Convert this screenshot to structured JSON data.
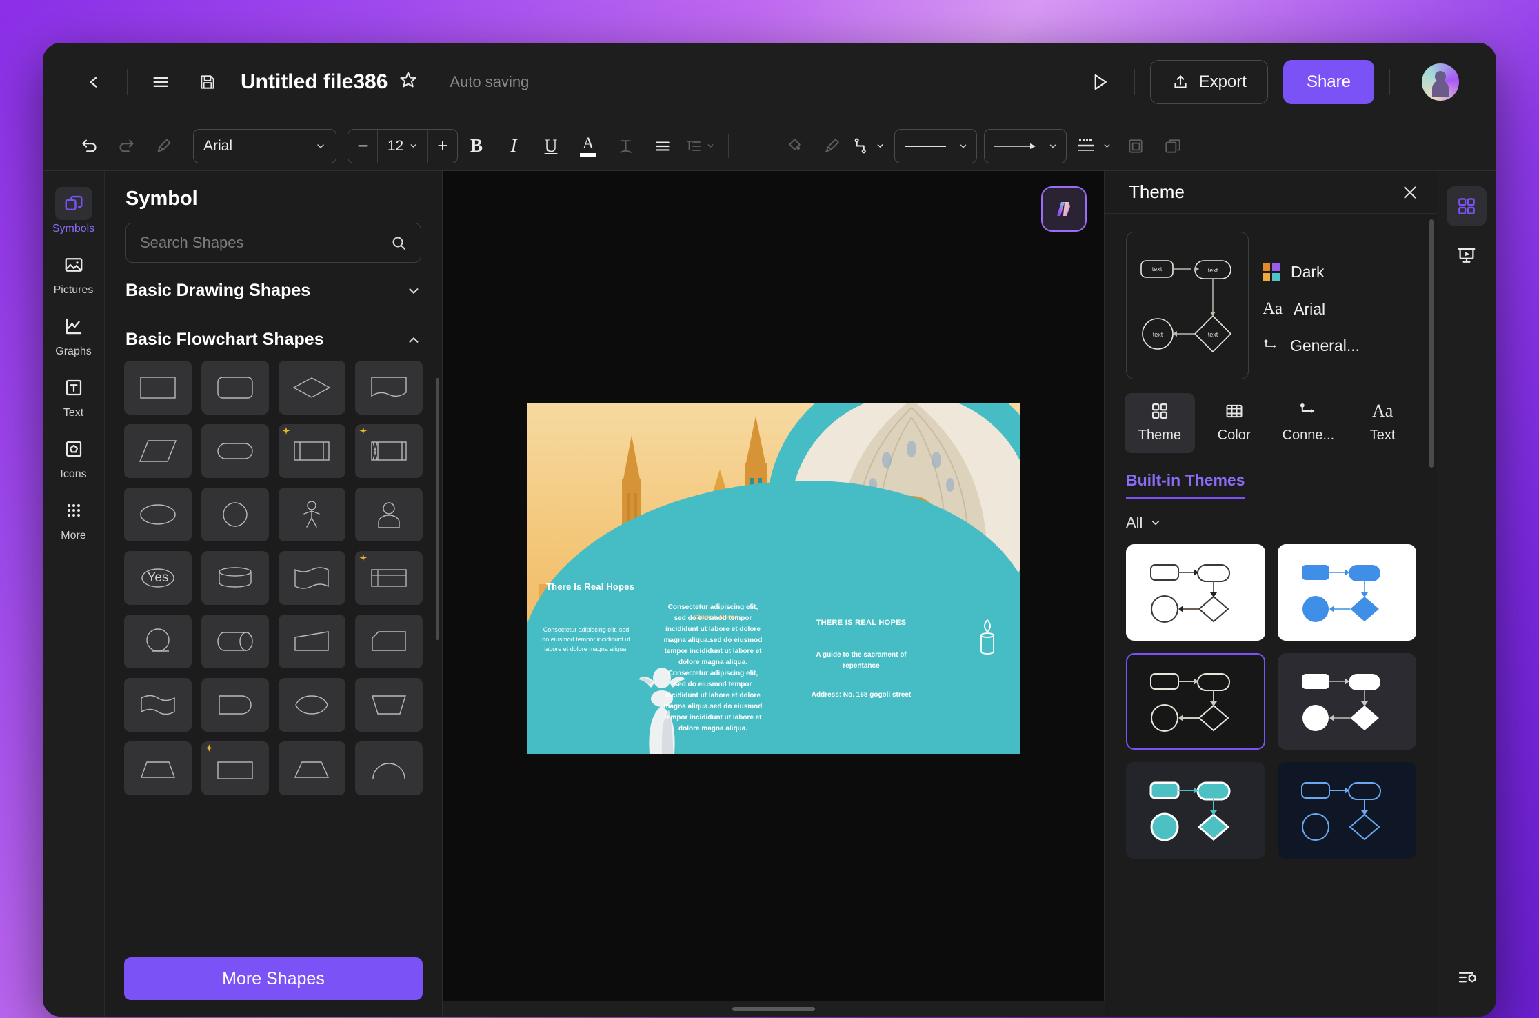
{
  "titlebar": {
    "back_icon": "chevron-left-icon",
    "menu_icon": "hamburger-menu-icon",
    "save_icon": "floppy-save-icon",
    "doc_title": "Untitled file386",
    "star_icon": "star-icon",
    "autosave_status": "Auto saving",
    "present_icon": "play-present-icon",
    "export_label": "Export",
    "share_label": "Share",
    "avatar": "user-avatar"
  },
  "toolbar": {
    "undo_icon": "undo-icon",
    "redo_icon": "redo-icon",
    "painter_icon": "format-painter-icon",
    "font_family": "Arial",
    "font_size": "12",
    "decrease": "−",
    "increase": "+",
    "bold": "B",
    "italic": "I",
    "underline": "U",
    "font_color": "A",
    "text_effect_icon": "text-effect-icon",
    "align_icon": "align-icon",
    "line_spacing_icon": "line-spacing-icon",
    "text_box_icon": "text-box-icon",
    "fill_icon": "fill-bucket-icon",
    "brush_icon": "brush-icon",
    "connector_icon": "connector-icon",
    "line_style_icon": "line-style-icon",
    "arrow_style_icon": "arrow-style-icon",
    "line_weight_icon": "line-weight-icon",
    "frame_icon": "frame-icon",
    "layer_icon": "layers-icon"
  },
  "left_rail": {
    "items": [
      {
        "label": "Symbols",
        "icon": "symbols-icon",
        "active": true
      },
      {
        "label": "Pictures",
        "icon": "picture-icon",
        "active": false
      },
      {
        "label": "Graphs",
        "icon": "graph-icon",
        "active": false
      },
      {
        "label": "Text",
        "icon": "text-icon",
        "active": false
      },
      {
        "label": "Icons",
        "icon": "icons-icon",
        "active": false
      },
      {
        "label": "More",
        "icon": "more-dots-icon",
        "active": false
      }
    ]
  },
  "symbol_panel": {
    "title": "Symbol",
    "search_placeholder": "Search Shapes",
    "search_value": "",
    "search_icon": "search-icon",
    "sections": [
      {
        "label": "Basic Drawing Shapes",
        "expanded": false,
        "chevron": "chevron-down-icon"
      },
      {
        "label": "Basic Flowchart Shapes",
        "expanded": true,
        "chevron": "chevron-up-icon"
      }
    ],
    "shapes": [
      {
        "name": "process-rectangle",
        "starred": false
      },
      {
        "name": "rounded-rectangle",
        "starred": false
      },
      {
        "name": "decision-diamond",
        "starred": false
      },
      {
        "name": "document-shape",
        "starred": false
      },
      {
        "name": "parallelogram-data",
        "starred": false
      },
      {
        "name": "stadium-terminator",
        "starred": false
      },
      {
        "name": "predefined-process",
        "starred": true
      },
      {
        "name": "internal-storage",
        "starred": true
      },
      {
        "name": "ellipse-shape",
        "starred": false
      },
      {
        "name": "circle-shape",
        "starred": false
      },
      {
        "name": "actor-person",
        "starred": false
      },
      {
        "name": "user-avatar-shape",
        "starred": false
      },
      {
        "name": "yes-ellipse",
        "starred": false,
        "text": "Yes"
      },
      {
        "name": "database-cylinder",
        "starred": false
      },
      {
        "name": "tape-shape",
        "starred": false
      },
      {
        "name": "table-shape",
        "starred": true
      },
      {
        "name": "circle-outline-shape",
        "starred": false
      },
      {
        "name": "direct-access-storage",
        "starred": false
      },
      {
        "name": "trapezoid-slant",
        "starred": false
      },
      {
        "name": "card-shape",
        "starred": false
      },
      {
        "name": "wave-document",
        "starred": false
      },
      {
        "name": "delay-shape",
        "starred": false
      },
      {
        "name": "loop-limit-shape",
        "starred": false
      },
      {
        "name": "manual-operation",
        "starred": false
      },
      {
        "name": "trapezoid-shape",
        "starred": false
      },
      {
        "name": "rect-partial",
        "starred": true
      },
      {
        "name": "hexagon-partial",
        "starred": false
      },
      {
        "name": "arc-partial",
        "starred": false
      }
    ],
    "more_shapes_label": "More Shapes"
  },
  "canvas": {
    "logo_badge": "app-logo-icon",
    "brochure": {
      "heading": "There Is Real Hopes",
      "church_name": "Church Name",
      "column1": "Consectetur adipiscing elit, sed do eiusmod tempor incididunt ut labore et dolore magna aliqua.",
      "column2": "Consectetur adipiscing elit, sed do eiusmod tempor incididunt ut labore et dolore magna aliqua.sed do eiusmod tempor incididunt ut labore et dolore magna aliqua. Consectetur adipiscing elit, sed do eiusmod tempor incididunt ut labore et dolore magna aliqua.sed do eiusmod tempor incididunt ut labore et dolore magna aliqua.",
      "tagline": "THERE IS REAL HOPES",
      "subtitle": "A guide to the sacrament of repentance",
      "address": "Address: No. 168 gogoli street",
      "candle_icon": "candle-icon",
      "angel_image": "angel-statue",
      "teal_color": "#46bcc4",
      "gold_color": "#f4c678"
    }
  },
  "theme_panel": {
    "title": "Theme",
    "close_icon": "close-icon",
    "preview_node_label": "text",
    "properties": [
      {
        "label": "Dark",
        "icon": "color-swatch-icon"
      },
      {
        "label": "Arial",
        "icon": "font-aa-icon"
      },
      {
        "label": "General...",
        "icon": "connector-icon"
      }
    ],
    "tabs": [
      {
        "label": "Theme",
        "icon": "theme-grid-icon",
        "active": true
      },
      {
        "label": "Color",
        "icon": "color-table-icon",
        "active": false
      },
      {
        "label": "Conne...",
        "icon": "connector-icon",
        "active": false
      },
      {
        "label": "Text",
        "icon": "font-aa-icon",
        "active": false
      }
    ],
    "section_label": "Built-in Themes",
    "filter_label": "All",
    "filter_icon": "chevron-down-icon",
    "themes": [
      {
        "name": "light-outline",
        "bg": "#ffffff",
        "shape_fill": "#ffffff",
        "stroke": "#3a3a3a",
        "selected": false
      },
      {
        "name": "light-blue",
        "bg": "#ffffff",
        "shape_fill": "#3f8fe8",
        "stroke": "#3f8fe8",
        "selected": false
      },
      {
        "name": "dark-outline",
        "bg": "#171717",
        "shape_fill": "#171717",
        "stroke": "#e8e4dc",
        "selected": true
      },
      {
        "name": "dark-white",
        "bg": "#2b2b31",
        "shape_fill": "#ffffff",
        "stroke": "#ffffff",
        "selected": false
      },
      {
        "name": "dark-teal",
        "bg": "#24242b",
        "shape_fill": "#4dc0c4",
        "stroke": "#ffffff",
        "selected": false
      },
      {
        "name": "navy-blue",
        "bg": "#0f1726",
        "shape_fill": "#0f1726",
        "stroke": "#6aa9f0",
        "selected": false
      }
    ],
    "accent_color": "#7b52f5"
  },
  "right_rail": {
    "items": [
      {
        "name": "theme-panel-toggle",
        "icon": "theme-grid-icon",
        "active": true
      },
      {
        "name": "presentation-toggle",
        "icon": "presentation-icon",
        "active": false
      }
    ],
    "bottom": {
      "name": "properties-toggle",
      "icon": "settings-sliders-icon"
    }
  }
}
